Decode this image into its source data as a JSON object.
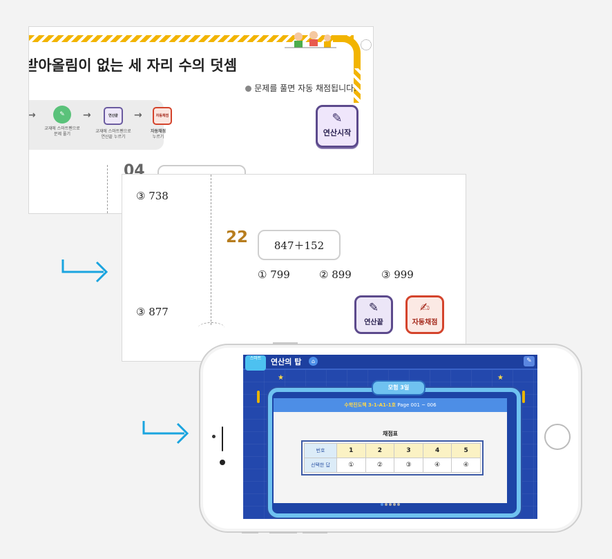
{
  "card1": {
    "title": "받아올림이 없는 세 자리 수의 덧셈",
    "notice": "문제를 풀면 자동 채점됩니다.",
    "steps": [
      {
        "icon": "",
        "line1": "교재에 스마트펜으로",
        "line2": "문제 풀기"
      },
      {
        "icon": "연산끝",
        "line1": "교재에 스마트펜으로",
        "line2": "연산끝 누르기"
      },
      {
        "icon": "자동채점",
        "line1": "자동채점",
        "line2": "누르기"
      }
    ],
    "start_button": "연산시작",
    "partial_number": "04"
  },
  "card2": {
    "item_a": "③ 738",
    "item_b": "③ 877",
    "problem_number": "22",
    "expression": "847＋152",
    "choices": [
      "① 799",
      "② 899",
      "③ 999"
    ],
    "end_button": "연산끝",
    "auto_button": "자동채점"
  },
  "phone": {
    "app_icon_text": "스마트",
    "app_title": "연산의 탑",
    "ribbon": "모험 3일",
    "subtitle_book": "수학진도책 3-1-A1-1호",
    "subtitle_page": "Page 001 ~ 006",
    "panel_title": "채점표",
    "table": {
      "row1_header": "번호",
      "row2_header": "선택한 답",
      "numbers": [
        "1",
        "2",
        "3",
        "4",
        "5"
      ],
      "answers": [
        "①",
        "②",
        "③",
        "④",
        "④"
      ]
    },
    "page_dots": 5,
    "active_page": 1
  },
  "colors": {
    "accent_yellow": "#f2b400",
    "problem_number": "#b77d1e",
    "connector": "#1aa4df",
    "start_border": "#5c4a8c",
    "auto_border": "#d4442c",
    "screen_blue": "#2348ad"
  },
  "icons": {
    "connector": "arrow-turn-right-icon",
    "pencil": "pencil-icon",
    "home": "home-icon",
    "edit": "edit-pencil-icon"
  }
}
